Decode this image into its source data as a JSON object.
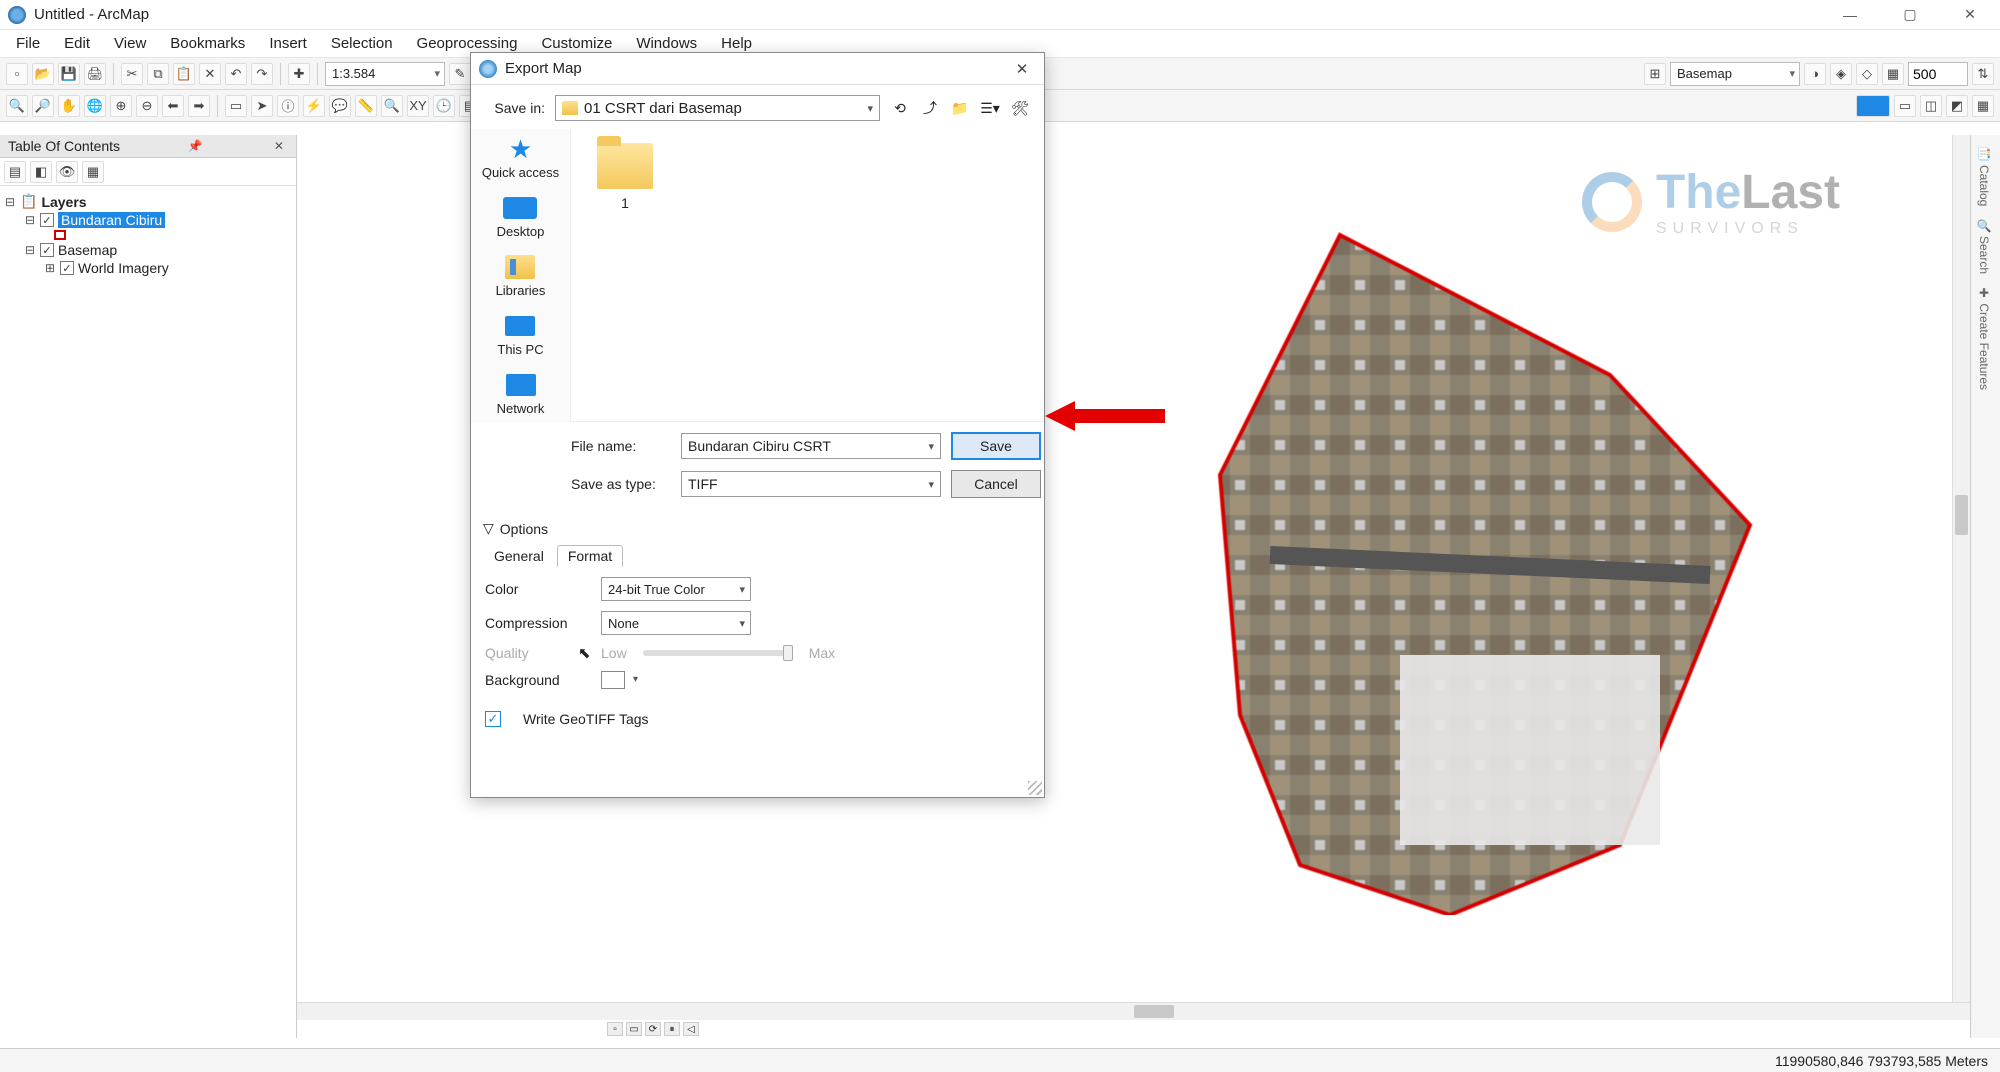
{
  "titlebar": {
    "title": "Untitled - ArcMap"
  },
  "menubar": [
    "File",
    "Edit",
    "View",
    "Bookmarks",
    "Insert",
    "Selection",
    "Geoprocessing",
    "Customize",
    "Windows",
    "Help"
  ],
  "toolbar": {
    "scale": "1:3.584",
    "basemap": "Basemap",
    "snap_value": "500"
  },
  "toc": {
    "title": "Table Of Contents",
    "root": "Layers",
    "layer_selected": "Bundaran Cibiru",
    "group_basemap": "Basemap",
    "layer_world": "World Imagery"
  },
  "watermark": {
    "brand_a": "The",
    "brand_b": "Last",
    "sub": "SURVIVORS"
  },
  "dialog": {
    "title": "Export Map",
    "save_in_label": "Save in:",
    "save_in_value": "01 CSRT dari Basemap",
    "sidebar": {
      "quick": "Quick access",
      "desktop": "Desktop",
      "libraries": "Libraries",
      "thispc": "This PC",
      "network": "Network"
    },
    "folder_item": "1",
    "file_name_label": "File name:",
    "file_name_value": "Bundaran Cibiru CSRT",
    "save_as_type_label": "Save as type:",
    "save_as_type_value": "TIFF",
    "save_btn": "Save",
    "cancel_btn": "Cancel",
    "options_label": "Options",
    "tabs": {
      "general": "General",
      "format": "Format"
    },
    "opts": {
      "color_label": "Color",
      "color_value": "24-bit True Color",
      "compression_label": "Compression",
      "compression_value": "None",
      "quality_label": "Quality",
      "quality_low": "Low",
      "quality_max": "Max",
      "background_label": "Background",
      "geotiff_label": "Write GeoTIFF Tags"
    }
  },
  "statusbar": {
    "coords": "11990580,846  793793,585 Meters"
  }
}
